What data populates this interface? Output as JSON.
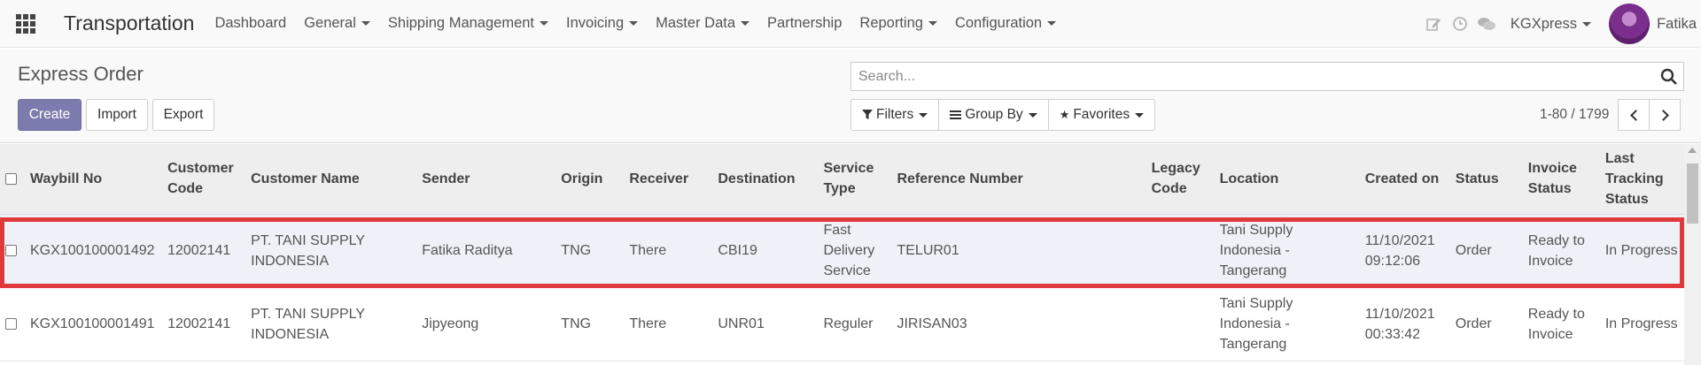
{
  "navbar": {
    "brand": "Transportation",
    "menu": [
      {
        "label": "Dashboard",
        "dropdown": false
      },
      {
        "label": "General",
        "dropdown": true
      },
      {
        "label": "Shipping Management",
        "dropdown": true
      },
      {
        "label": "Invoicing",
        "dropdown": true
      },
      {
        "label": "Master Data",
        "dropdown": true
      },
      {
        "label": "Partnership",
        "dropdown": false
      },
      {
        "label": "Reporting",
        "dropdown": true
      },
      {
        "label": "Configuration",
        "dropdown": true
      }
    ],
    "company": "KGXpress",
    "user": "Fatika"
  },
  "control": {
    "title": "Express Order",
    "create_label": "Create",
    "import_label": "Import",
    "export_label": "Export",
    "search_placeholder": "Search...",
    "filters_label": "Filters",
    "groupby_label": "Group By",
    "favorites_label": "Favorites",
    "pager": "1-80 / 1799"
  },
  "table": {
    "columns": [
      "Waybill No",
      "Customer Code",
      "Customer Name",
      "Sender",
      "Origin",
      "Receiver",
      "Destination",
      "Service Type",
      "Reference Number",
      "Legacy Code",
      "Location",
      "Created on",
      "Status",
      "Invoice Status",
      "Last Tracking Status"
    ],
    "rows": [
      {
        "waybill": "KGX100100001492",
        "customer_code": "12002141",
        "customer_name": "PT. TANI SUPPLY INDONESIA",
        "sender": "Fatika Raditya",
        "origin": "TNG",
        "receiver": "There",
        "destination": "CBI19",
        "service_type": "Fast Delivery Service",
        "reference": "TELUR01",
        "legacy": "",
        "location": "Tani Supply Indonesia - Tangerang",
        "created": "11/10/2021 09:12:06",
        "status": "Order",
        "invoice_status": "Ready to Invoice",
        "tracking": "In Progress"
      },
      {
        "waybill": "KGX100100001491",
        "customer_code": "12002141",
        "customer_name": "PT. TANI SUPPLY INDONESIA",
        "sender": "Jipyeong",
        "origin": "TNG",
        "receiver": "There",
        "destination": "UNR01",
        "service_type": "Reguler",
        "reference": "JIRISAN03",
        "legacy": "",
        "location": "Tani Supply Indonesia - Tangerang",
        "created": "11/10/2021 00:33:42",
        "status": "Order",
        "invoice_status": "Ready to Invoice",
        "tracking": "In Progress"
      }
    ]
  },
  "colors": {
    "primary": "#7c7bad",
    "highlight": "#e0393b",
    "selected_row": "#eef1f7"
  }
}
